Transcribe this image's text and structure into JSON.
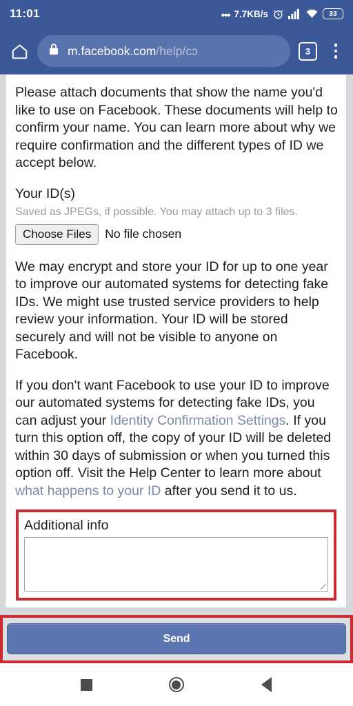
{
  "status_bar": {
    "time": "11:01",
    "network_speed": "7.7KB/s",
    "speed_prefix": "•••",
    "alarm_icon": "alarm-clock-icon",
    "signal_icon": "signal-bars-icon",
    "wifi_icon": "wifi-icon",
    "battery_level": "33"
  },
  "browser": {
    "home_icon": "home-icon",
    "lock_icon": "lock-icon",
    "url_host": "m.facebook.com",
    "url_path": "/help/cɔ",
    "tab_count": "3",
    "menu_icon": "kebab-menu-icon"
  },
  "page": {
    "intro_paragraph": "Please attach documents that show the name you'd like to use on Facebook. These documents will help to confirm your name. You can learn more about why we require confirmation and the different types of ID we accept below.",
    "id_section": {
      "title": "Your ID(s)",
      "subtitle": "Saved as JPEGs, if possible. You may attach up to 3 files.",
      "choose_files_label": "Choose Files",
      "file_status": "No file chosen"
    },
    "encrypt_paragraph": "We may encrypt and store your ID for up to one year to improve our automated systems for detecting fake IDs. We might use trusted service providers to help review your information. Your ID will be stored securely and will not be visible to anyone on Facebook.",
    "optout_paragraph": {
      "part1": "If you don't want Facebook to use your ID to improve our automated systems for detecting fake IDs, you can adjust your ",
      "link1": "Identity Confirmation Settings",
      "part2": ". If you turn this option off, the copy of your ID will be deleted within 30 days of submission or when you turned this option off. Visit the Help Center to learn more about ",
      "link2": "what happens to your ID",
      "part3": " after you send it to us."
    },
    "additional_info": {
      "label": "Additional info",
      "value": "",
      "placeholder": ""
    },
    "send_label": "Send"
  },
  "nav_bar": {
    "recents_icon": "square-recents-icon",
    "home_icon": "circle-home-icon",
    "back_icon": "triangle-back-icon"
  },
  "colors": {
    "chrome_blue": "#3b5998",
    "omnibox_blue": "#5973ac",
    "link_blue": "#7b8aa6",
    "highlight_red": "#cc2a2f",
    "send_blue": "#5b76b0",
    "page_bg": "#d6d8dc"
  }
}
